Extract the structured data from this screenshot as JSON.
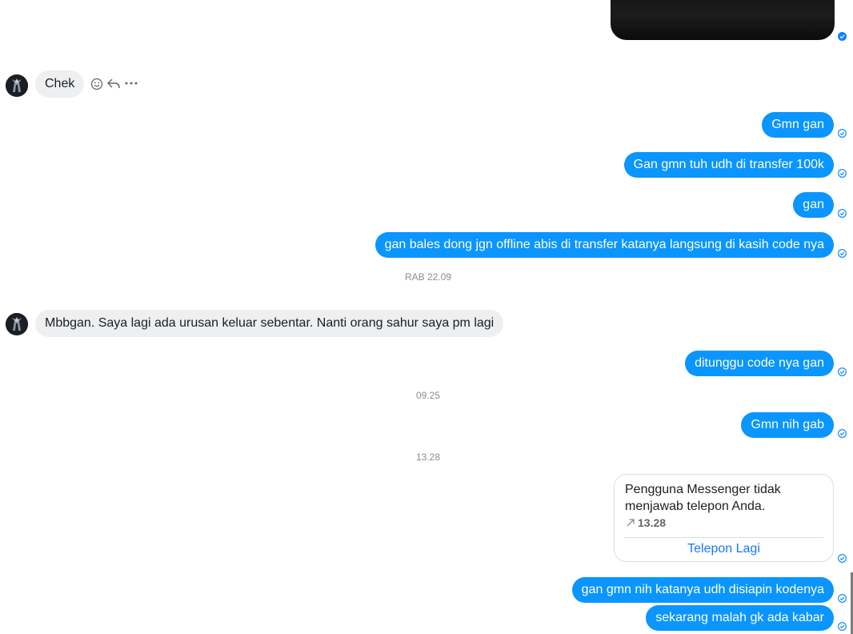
{
  "conversation": {
    "messages": [
      {
        "id": "m1",
        "from": "them",
        "text": "Chek"
      },
      {
        "id": "m2",
        "from": "me",
        "text": "Gmn gan"
      },
      {
        "id": "m3",
        "from": "me",
        "text": "Gan gmn tuh udh di transfer 100k"
      },
      {
        "id": "m4",
        "from": "me",
        "text": "gan"
      },
      {
        "id": "m5",
        "from": "me",
        "text": "gan bales dong jgn offline abis di transfer katanya langsung di kasih code nya"
      },
      {
        "id": "m6",
        "from": "them",
        "text": "Mbbgan. Saya lagi ada urusan keluar sebentar. Nanti orang sahur saya pm lagi"
      },
      {
        "id": "m7",
        "from": "me",
        "text": "ditunggu code nya gan"
      },
      {
        "id": "m8",
        "from": "me",
        "text": "Gmn nih gab"
      },
      {
        "id": "m9",
        "from": "me",
        "text": "gan gmn nih katanya udh disiapin kodenya"
      },
      {
        "id": "m10",
        "from": "me",
        "text": "sekarang malah gk ada kabar"
      }
    ],
    "timestamps": {
      "t1": "RAB 22.09",
      "t2": "09.25",
      "t3": "13.28"
    },
    "call_card": {
      "title": "Pengguna Messenger tidak menjawab telepon Anda.",
      "time": "13.28",
      "action": "Telepon Lagi"
    }
  },
  "colors": {
    "outgoing_bubble": "#0a95ff",
    "incoming_bubble": "#eeeff1",
    "status_icon": "#0a84ff",
    "timestamp": "#8a8d91",
    "link": "#1877f2"
  },
  "icons": {
    "react": "smile-icon",
    "reply": "reply-icon",
    "more": "more-icon",
    "status": "sent-check-icon"
  }
}
